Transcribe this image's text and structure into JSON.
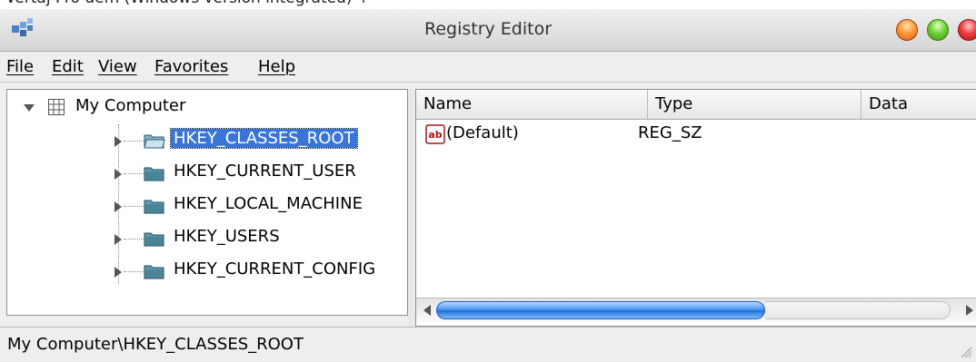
{
  "caption": "Vertaj Pro dem (Windows version integrated) +",
  "window": {
    "title": "Registry Editor",
    "app_icon": "registry-app-icon"
  },
  "menu": {
    "file": "File",
    "edit": "Edit",
    "view": "View",
    "favorites": "Favorites",
    "help": "Help"
  },
  "tree": {
    "root": {
      "label": "My Computer",
      "icon": "computer-icon",
      "expanded": true
    },
    "children": [
      {
        "label": "HKEY_CLASSES_ROOT",
        "selected": true,
        "icon": "open-folder-icon"
      },
      {
        "label": "HKEY_CURRENT_USER",
        "selected": false,
        "icon": "folder-icon"
      },
      {
        "label": "HKEY_LOCAL_MACHINE",
        "selected": false,
        "icon": "folder-icon"
      },
      {
        "label": "HKEY_USERS",
        "selected": false,
        "icon": "folder-icon"
      },
      {
        "label": "HKEY_CURRENT_CONFIG",
        "selected": false,
        "icon": "folder-icon"
      }
    ]
  },
  "list": {
    "columns": [
      "Name",
      "Type",
      "Data"
    ],
    "rows": [
      {
        "name": "(Default)",
        "type": "REG_SZ",
        "data": "",
        "icon": "string-value-icon"
      }
    ]
  },
  "status": {
    "path": "My Computer\\HKEY_CLASSES_ROOT"
  },
  "colors": {
    "selection": "#3875d7",
    "scroll_thumb": "#3c8ff0"
  }
}
